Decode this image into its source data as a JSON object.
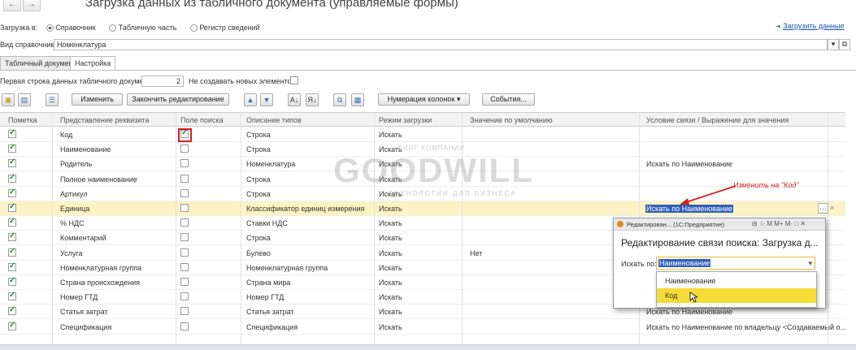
{
  "window": {
    "title": "Загрузка данных из табличного документа (управляемые формы)",
    "back_glyph": "←",
    "forward_glyph": "→"
  },
  "load_to": {
    "label": "Загрузка в:",
    "options": [
      "Справочник",
      "Табличную часть",
      "Регистр сведений"
    ],
    "selected": "Справочник"
  },
  "load_data_link": "Загрузить данные",
  "catalog": {
    "label": "Вид справочника:",
    "value": "Номенклатура"
  },
  "tabs": [
    "Табличный документ",
    "Настройка"
  ],
  "active_tab": "Настройка",
  "settings": {
    "first_row_label": "Первая строка данных табличного документа:",
    "first_row_value": "2",
    "no_new_label": "Не создавать новых элементов:"
  },
  "toolbar": {
    "change": "Изменить",
    "finish_edit": "Закончить редактирование",
    "numbering": "Нумерация колонок",
    "events": "События..."
  },
  "table": {
    "columns": [
      "Пометка",
      "Представление реквизита",
      "Поле поиска",
      "Описание типов",
      "Режим загрузки",
      "Значение по умолчанию",
      "Условие связи / Выражение для значения"
    ],
    "rows": [
      {
        "mark": true,
        "name": "Код",
        "search": true,
        "type": "Строка",
        "mode": "Искать",
        "default": "",
        "cond": ""
      },
      {
        "mark": true,
        "name": "Наименование",
        "search": false,
        "type": "Строка",
        "mode": "Искать",
        "default": "",
        "cond": ""
      },
      {
        "mark": true,
        "name": "Родитель",
        "search": false,
        "type": "Номенклатура",
        "mode": "Искать",
        "default": "",
        "cond": "Искать по Наименование"
      },
      {
        "mark": true,
        "name": "Полное наименование",
        "search": false,
        "type": "Строка",
        "mode": "Искать",
        "default": "",
        "cond": ""
      },
      {
        "mark": true,
        "name": "Артикул",
        "search": false,
        "type": "Строка",
        "mode": "Искать",
        "default": "",
        "cond": ""
      },
      {
        "mark": true,
        "name": "Единица",
        "search": false,
        "type": "Классификатор единиц измерения",
        "mode": "Искать",
        "default": "",
        "cond": "Искать по Наименование"
      },
      {
        "mark": true,
        "name": "% НДС",
        "search": false,
        "type": "Ставки НДС",
        "mode": "Искать",
        "default": "",
        "cond": ""
      },
      {
        "mark": true,
        "name": "Комментарий",
        "search": false,
        "type": "Строка",
        "mode": "Искать",
        "default": "",
        "cond": ""
      },
      {
        "mark": true,
        "name": "Услуга",
        "search": false,
        "type": "Булево",
        "mode": "Искать",
        "default": "Нет",
        "cond": ""
      },
      {
        "mark": true,
        "name": "Номенклатурная группа",
        "search": false,
        "type": "Номенклатурная группа",
        "mode": "Искать",
        "default": "",
        "cond": ""
      },
      {
        "mark": true,
        "name": "Страна происхождения",
        "search": false,
        "type": "Страна мира",
        "mode": "Искать",
        "default": "",
        "cond": ""
      },
      {
        "mark": true,
        "name": "Номер ГТД",
        "search": false,
        "type": "Номер ГТД",
        "mode": "Искать",
        "default": "",
        "cond": ""
      },
      {
        "mark": true,
        "name": "Статья затрат",
        "search": false,
        "type": "Статья затрат",
        "mode": "Искать",
        "default": "",
        "cond": "Искать по Наименование"
      },
      {
        "mark": true,
        "name": "Спецификация",
        "search": false,
        "type": "Спецификация",
        "mode": "Искать",
        "default": "",
        "cond": "Искать по Наименование по владельцу <Создаваемый о..."
      }
    ],
    "selected_row": 5
  },
  "annotation": "Изменить на \"Код\"",
  "watermark": {
    "brand": "GOODWILL",
    "top": "БЛОГ КОМПАНИИ",
    "bottom": "ТЕХНОЛОГИИ ДЛЯ БИЗНЕСА"
  },
  "popup": {
    "window_title": "Редактирован... (1С:Предприятие)",
    "heading": "Редактирование связи поиска: Загрузка д...",
    "search_by_label": "Искать по:",
    "search_by_value": "Наименование",
    "options": [
      "Наименование",
      "Код"
    ],
    "highlighted": "Код",
    "window_buttons": "⊟ ☆ M M+ M- □ ✕"
  },
  "colors": {
    "selected_row": "#fbf3c4",
    "highlight": "#f6dc36",
    "link": "#1a55a6",
    "annotation": "#d42020",
    "checkmark": "#1e8f2e"
  }
}
